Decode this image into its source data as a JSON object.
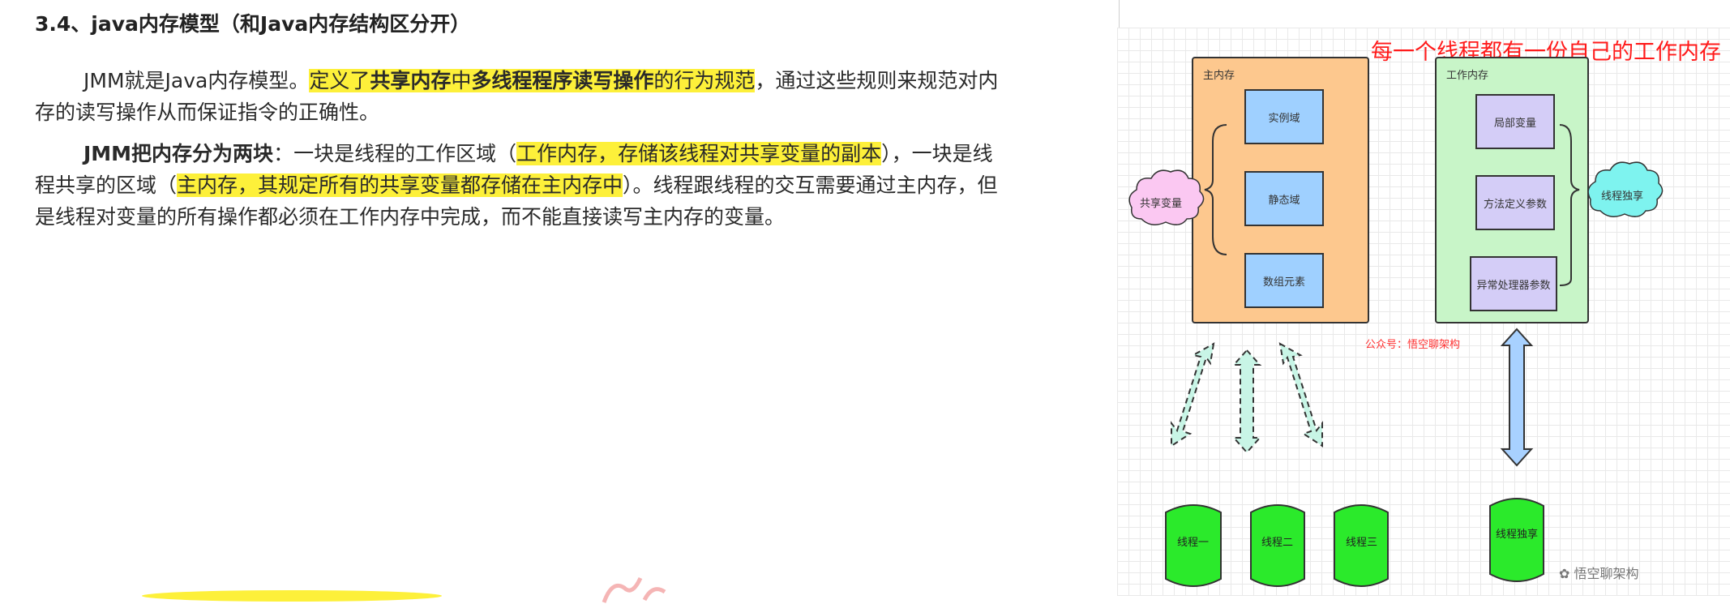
{
  "heading": "3.4、java内存模型（和Java内存结构区分开）",
  "para1": {
    "t1": "JMM就是Java内存模型。",
    "h1": "定义了",
    "h1b": "共享内存",
    "h2": "中",
    "h2b": "多线程程序读写操作",
    "h3": "的行为规范",
    "t2": "，通过这些规则来规范对内存的读写操作从而保证指令的正确性。"
  },
  "para2": {
    "b1": "JMM把内存分为两块",
    "t1": "：一块是线程的工作区域（",
    "h1": "工作内存，存储该线程对共享变量的副本",
    "t2": "），一块是线程共享的区域（",
    "h2": "主内存，其规定所有的共享变量都存储在主内存中",
    "t3": "）。线程跟线程的交互需要通过主内存，但是线程对变量的所有操作都必须在工作内存中完成，而不能直接读写主内存的变量。"
  },
  "diagram": {
    "title": "每一个线程都有一份自己的工作内存",
    "main_memory": {
      "label": "主内存",
      "items": [
        "实例域",
        "静态域",
        "数组元素"
      ]
    },
    "work_memory": {
      "label": "工作内存",
      "items": [
        "局部变量",
        "方法定义参数",
        "异常处理器参数"
      ]
    },
    "shared_cloud": "共享变量",
    "private_cloud": "线程独享",
    "red_watermark": "公众号：悟空聊架构",
    "threads": [
      "线程一",
      "线程二",
      "线程三"
    ],
    "private_thread": "线程独享",
    "wechat_watermark": "悟空聊架构"
  },
  "colors": {
    "highlight": "#fdf03a",
    "main_memory": "#fdc88e",
    "work_memory": "#c8f5c8",
    "cell_blue": "#9fd0ff",
    "cell_purple": "#d4cdf7",
    "thread_green": "#2bea2b",
    "title_red": "#ff1a1a"
  }
}
